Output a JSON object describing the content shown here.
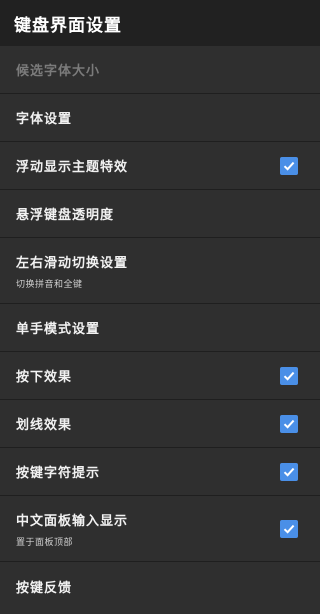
{
  "appbar": {
    "title": "键盘界面设置"
  },
  "items": [
    {
      "label": "候选字体大小",
      "disabled": true
    },
    {
      "label": "字体设置"
    },
    {
      "label": "浮动显示主题特效",
      "checked": true
    },
    {
      "label": "悬浮键盘透明度"
    },
    {
      "label": "左右滑动切换设置",
      "sub": "切换拼音和全键"
    },
    {
      "label": "单手模式设置"
    },
    {
      "label": "按下效果",
      "checked": true
    },
    {
      "label": "划线效果",
      "checked": true
    },
    {
      "label": "按键字符提示",
      "checked": true
    },
    {
      "label": "中文面板输入显示",
      "sub": "置于面板顶部",
      "checked": true
    },
    {
      "label": "按键反馈"
    }
  ],
  "colors": {
    "checkbox": "#4a8fe7",
    "background": "#2f2f2f",
    "appbar": "#212121"
  },
  "icons": {
    "checkbox": "checkmark-icon"
  }
}
